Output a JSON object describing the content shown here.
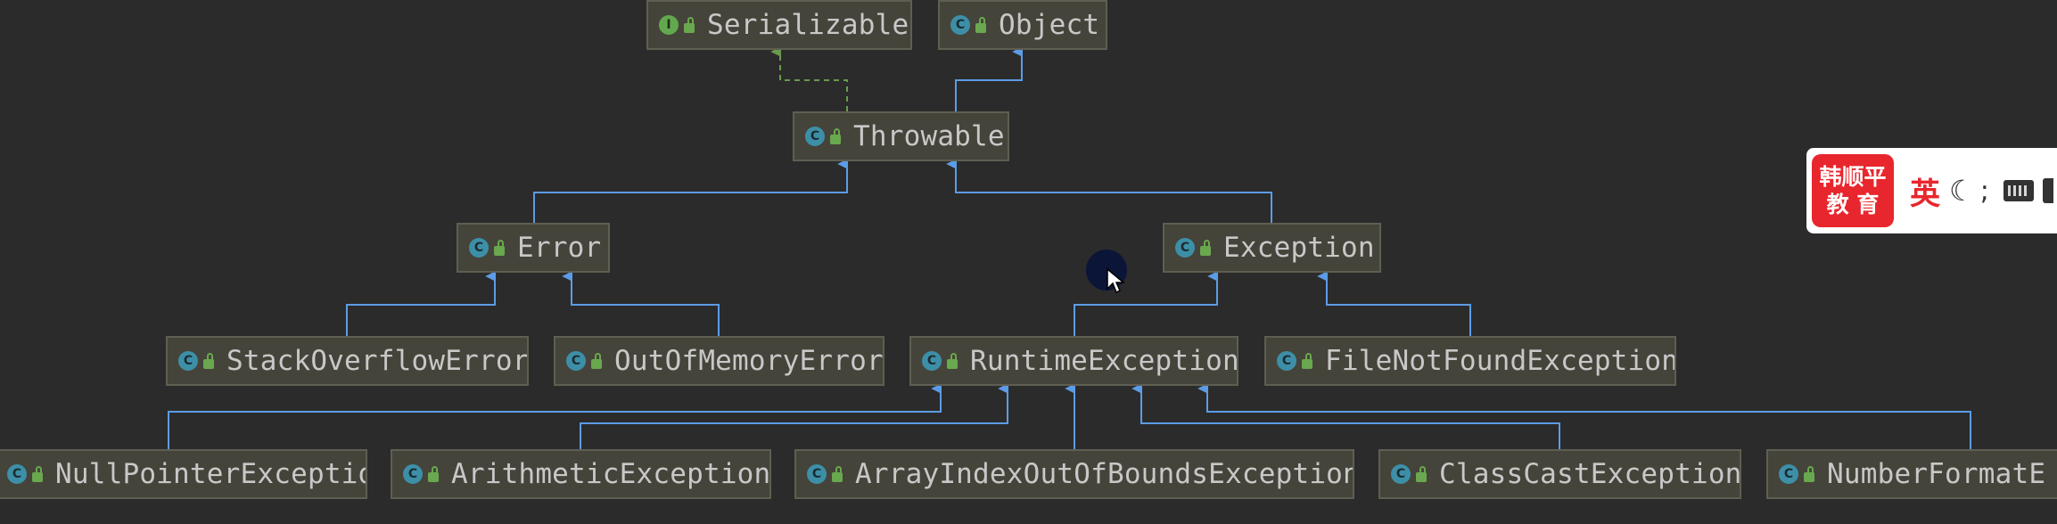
{
  "diagram": {
    "nodes": [
      {
        "id": "serializable",
        "label": "Serializable",
        "kind": "interface",
        "icon": "I"
      },
      {
        "id": "object",
        "label": "Object",
        "kind": "class",
        "icon": "C"
      },
      {
        "id": "throwable",
        "label": "Throwable",
        "kind": "class",
        "icon": "C"
      },
      {
        "id": "error",
        "label": "Error",
        "kind": "class",
        "icon": "C"
      },
      {
        "id": "exception",
        "label": "Exception",
        "kind": "class",
        "icon": "C"
      },
      {
        "id": "stackoverflowerror",
        "label": "StackOverflowError",
        "kind": "class",
        "icon": "C"
      },
      {
        "id": "outofmemoryerror",
        "label": "OutOfMemoryError",
        "kind": "class",
        "icon": "C"
      },
      {
        "id": "runtimeexception",
        "label": "RuntimeException",
        "kind": "class",
        "icon": "C"
      },
      {
        "id": "filenotfoundexception",
        "label": "FileNotFoundException",
        "kind": "class",
        "icon": "C"
      },
      {
        "id": "nullpointerexception",
        "label": "NullPointerException",
        "kind": "class",
        "icon": "C"
      },
      {
        "id": "arithmeticexception",
        "label": "ArithmeticException",
        "kind": "class",
        "icon": "C"
      },
      {
        "id": "arrayindexoutofboundsexception",
        "label": "ArrayIndexOutOfBoundsException",
        "kind": "class",
        "icon": "C"
      },
      {
        "id": "classcastexception",
        "label": "ClassCastException",
        "kind": "class",
        "icon": "C"
      },
      {
        "id": "numberformatexception",
        "label": "NumberFormatE",
        "kind": "class",
        "icon": "C"
      }
    ],
    "edges": [
      {
        "from": "throwable",
        "to": "serializable",
        "type": "implements"
      },
      {
        "from": "throwable",
        "to": "object",
        "type": "extends"
      },
      {
        "from": "error",
        "to": "throwable",
        "type": "extends"
      },
      {
        "from": "exception",
        "to": "throwable",
        "type": "extends"
      },
      {
        "from": "stackoverflowerror",
        "to": "error",
        "type": "extends"
      },
      {
        "from": "outofmemoryerror",
        "to": "error",
        "type": "extends"
      },
      {
        "from": "runtimeexception",
        "to": "exception",
        "type": "extends"
      },
      {
        "from": "filenotfoundexception",
        "to": "exception",
        "type": "extends"
      },
      {
        "from": "nullpointerexception",
        "to": "runtimeexception",
        "type": "extends"
      },
      {
        "from": "arithmeticexception",
        "to": "runtimeexception",
        "type": "extends"
      },
      {
        "from": "arrayindexoutofboundsexception",
        "to": "runtimeexception",
        "type": "extends"
      },
      {
        "from": "classcastexception",
        "to": "runtimeexception",
        "type": "extends"
      },
      {
        "from": "numberformatexception",
        "to": "runtimeexception",
        "type": "extends"
      }
    ],
    "colors": {
      "background": "#2b2b2b",
      "node_fill": "#45443a",
      "extends_edge": "#5c9ce6",
      "implements_edge": "#6a9a4e"
    }
  },
  "ime_toolbar": {
    "logo_line1": "韩顺平",
    "logo_line2": "教 育",
    "language": "英",
    "punctuation": ";",
    "icons": [
      "moon-icon",
      "keyboard-icon"
    ]
  }
}
